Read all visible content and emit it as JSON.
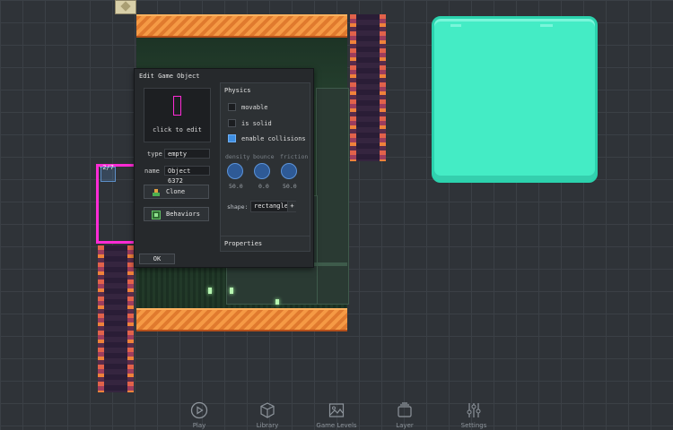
{
  "dialog": {
    "title": "Edit Game Object",
    "preview_label": "click to edit",
    "type_label": "type",
    "type_value": "empty",
    "name_label": "name",
    "name_value": "Object 6372",
    "clone_label": "Clone",
    "behaviors_label": "Behaviors",
    "ok_label": "OK",
    "physics": {
      "title": "Physics",
      "checkboxes": [
        {
          "label": "movable",
          "checked": false
        },
        {
          "label": "is solid",
          "checked": false
        },
        {
          "label": "enable collisions",
          "checked": true
        }
      ],
      "dials": [
        {
          "label": "density",
          "value": "50.0"
        },
        {
          "label": "bounce",
          "value": "0.0"
        },
        {
          "label": "friction",
          "value": "50.0"
        }
      ],
      "shape_label": "shape:",
      "shape_value": "rectangle",
      "shape_plus": "+"
    },
    "properties_title": "Properties"
  },
  "canvas": {
    "selection_label": "-2/7"
  },
  "toolbar": {
    "items": [
      {
        "label": "Play",
        "icon": "play-icon"
      },
      {
        "label": "Library",
        "icon": "cube-icon"
      },
      {
        "label": "Game Levels",
        "icon": "image-icon"
      },
      {
        "label": "Layer",
        "icon": "layers-icon"
      },
      {
        "label": "Settings",
        "icon": "sliders-icon"
      }
    ]
  },
  "colors": {
    "background": "#2f3338",
    "accent_mint": "#44ecc5",
    "selection_magenta": "#ff2bd6",
    "checkbox_on": "#3f8fe3",
    "orange": "#f59a45"
  }
}
